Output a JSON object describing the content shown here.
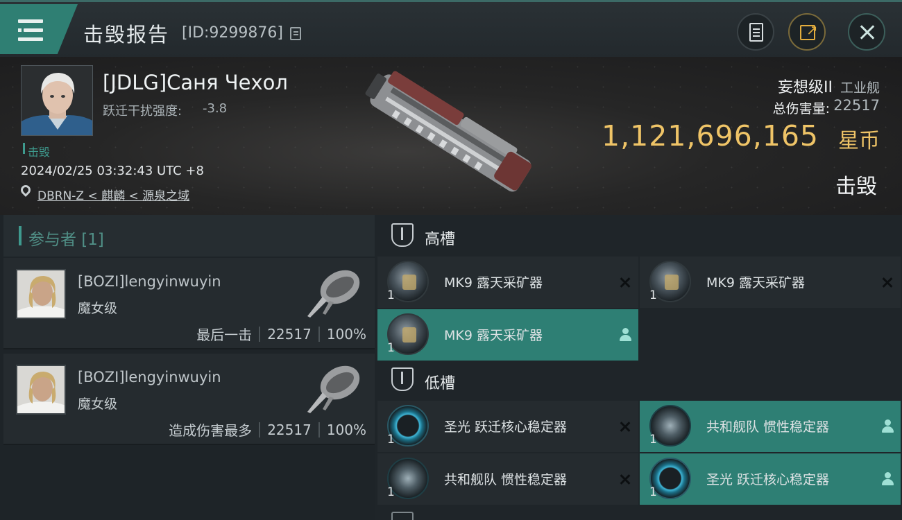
{
  "header": {
    "title": "击毁报告",
    "report_id": "[ID:9299876]"
  },
  "victim": {
    "name": "[JDLG]Саня Чехол",
    "warp_label": "跃迁干扰强度:",
    "warp_value": "-3.8",
    "status": "击毁",
    "datetime": "2024/02/25 03:32:43 UTC +8",
    "location": "DBRN-Z < 麒麟 < 源泉之域",
    "ship_class": "妄想级II",
    "ship_type": "工业舰",
    "total_damage_label": "总伤害量:",
    "total_damage": "22517",
    "isk_value": "1,121,696,165",
    "isk_unit": "星币",
    "result": "击毁"
  },
  "participants": {
    "title": "参与者 [1]",
    "rows": [
      {
        "name": "[BOZI]lengyinwuyin",
        "ship": "魔女级",
        "tag": "最后一击",
        "damage": "22517",
        "percent": "100%"
      },
      {
        "name": "[BOZI]lengyinwuyin",
        "ship": "魔女级",
        "tag": "造成伤害最多",
        "damage": "22517",
        "percent": "100%"
      }
    ]
  },
  "fittings": {
    "high_title": "高槽",
    "low_title": "低槽",
    "high": [
      {
        "qty": "1",
        "name": "MK9 露天采矿器",
        "state": "destroyed"
      },
      {
        "qty": "1",
        "name": "MK9 露天采矿器",
        "state": "destroyed"
      },
      {
        "qty": "1",
        "name": "MK9 露天采矿器",
        "state": "dropped"
      }
    ],
    "low": [
      {
        "qty": "1",
        "name": "圣光 跃迁核心稳定器",
        "state": "destroyed"
      },
      {
        "qty": "1",
        "name": "共和舰队 惯性稳定器",
        "state": "dropped"
      },
      {
        "qty": "1",
        "name": "共和舰队 惯性稳定器",
        "state": "destroyed"
      },
      {
        "qty": "1",
        "name": "圣光 跃迁核心稳定器",
        "state": "dropped"
      }
    ]
  },
  "colors": {
    "accent": "#2e7f74",
    "isk": "#efc467",
    "teal_text": "#3e9a8d"
  }
}
